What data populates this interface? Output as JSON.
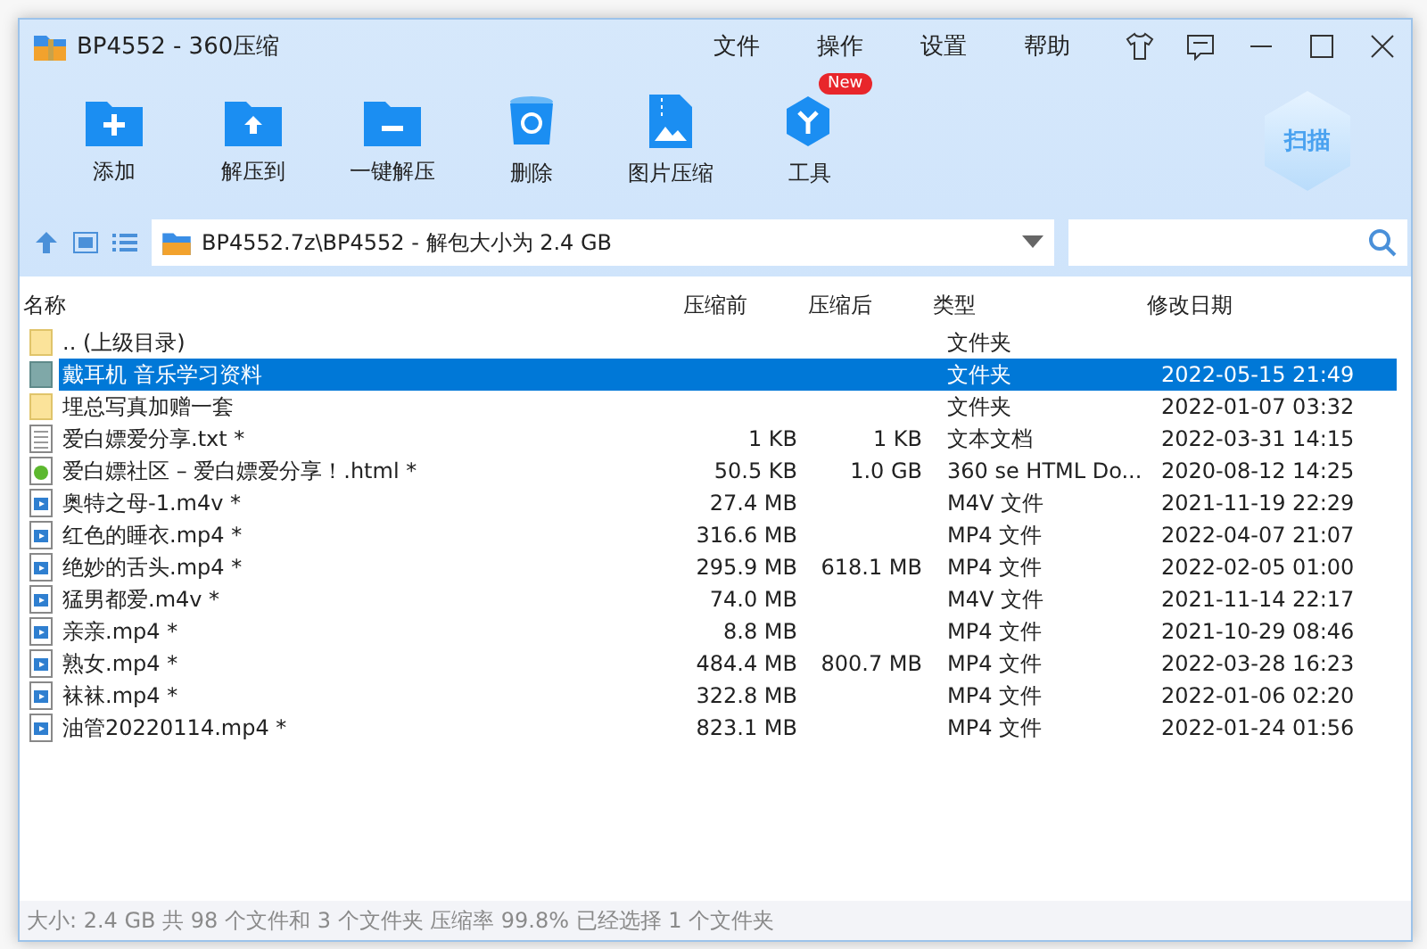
{
  "window": {
    "title": "BP4552 - 360压缩",
    "menu": [
      "文件",
      "操作",
      "设置",
      "帮助"
    ]
  },
  "toolbar": [
    {
      "label": "添加",
      "kind": "add"
    },
    {
      "label": "解压到",
      "kind": "extract"
    },
    {
      "label": "一键解压",
      "kind": "oneclick"
    },
    {
      "label": "删除",
      "kind": "delete"
    },
    {
      "label": "图片压缩",
      "kind": "image"
    },
    {
      "label": "工具",
      "kind": "tools",
      "badge": "New"
    }
  ],
  "scan_button": "扫描",
  "address": "BP4552.7z\\BP4552 - 解包大小为 2.4 GB",
  "table": {
    "columns": [
      "名称",
      "压缩前",
      "压缩后",
      "类型",
      "修改日期"
    ],
    "rows": [
      {
        "kind": "folder",
        "name": ".. (上级目录)",
        "size": "",
        "packed": "",
        "type": "文件夹",
        "date": "",
        "selected": false
      },
      {
        "kind": "folder-dark",
        "name": "戴耳机 音乐学习资料",
        "size": "",
        "packed": "",
        "type": "文件夹",
        "date": "2022-05-15 21:49",
        "selected": true
      },
      {
        "kind": "folder",
        "name": "埋总写真加赠一套",
        "size": "",
        "packed": "",
        "type": "文件夹",
        "date": "2022-01-07 03:32",
        "selected": false
      },
      {
        "kind": "text",
        "name": "爱白嫖爱分享.txt *",
        "size": "1 KB",
        "packed": "1 KB",
        "type": "文本文档",
        "date": "2022-03-31 14:15",
        "selected": false
      },
      {
        "kind": "html",
        "name": "爱白嫖社区 – 爱白嫖爱分享！.html *",
        "size": "50.5 KB",
        "packed": "1.0 GB",
        "type": "360 se HTML Do...",
        "date": "2020-08-12 14:25",
        "selected": false
      },
      {
        "kind": "video",
        "name": "奥特之母-1.m4v *",
        "size": "27.4 MB",
        "packed": "",
        "type": "M4V 文件",
        "date": "2021-11-19 22:29",
        "selected": false
      },
      {
        "kind": "video",
        "name": "红色的睡衣.mp4 *",
        "size": "316.6 MB",
        "packed": "",
        "type": "MP4 文件",
        "date": "2022-04-07 21:07",
        "selected": false
      },
      {
        "kind": "video",
        "name": "绝妙的舌头.mp4 *",
        "size": "295.9 MB",
        "packed": "618.1 MB",
        "type": "MP4 文件",
        "date": "2022-02-05 01:00",
        "selected": false
      },
      {
        "kind": "video",
        "name": "猛男都爱.m4v *",
        "size": "74.0 MB",
        "packed": "",
        "type": "M4V 文件",
        "date": "2021-11-14 22:17",
        "selected": false
      },
      {
        "kind": "video",
        "name": "亲亲.mp4 *",
        "size": "8.8 MB",
        "packed": "",
        "type": "MP4 文件",
        "date": "2021-10-29 08:46",
        "selected": false
      },
      {
        "kind": "video",
        "name": "熟女.mp4 *",
        "size": "484.4 MB",
        "packed": "800.7 MB",
        "type": "MP4 文件",
        "date": "2022-03-28 16:23",
        "selected": false
      },
      {
        "kind": "video",
        "name": "袜袜.mp4 *",
        "size": "322.8 MB",
        "packed": "",
        "type": "MP4 文件",
        "date": "2022-01-06 02:20",
        "selected": false
      },
      {
        "kind": "video",
        "name": "油管20220114.mp4 *",
        "size": "823.1 MB",
        "packed": "",
        "type": "MP4 文件",
        "date": "2022-01-24 01:56",
        "selected": false
      }
    ]
  },
  "status_bar": "大小: 2.4 GB 共 98 个文件和 3 个文件夹 压缩率 99.8% 已经选择 1 个文件夹"
}
